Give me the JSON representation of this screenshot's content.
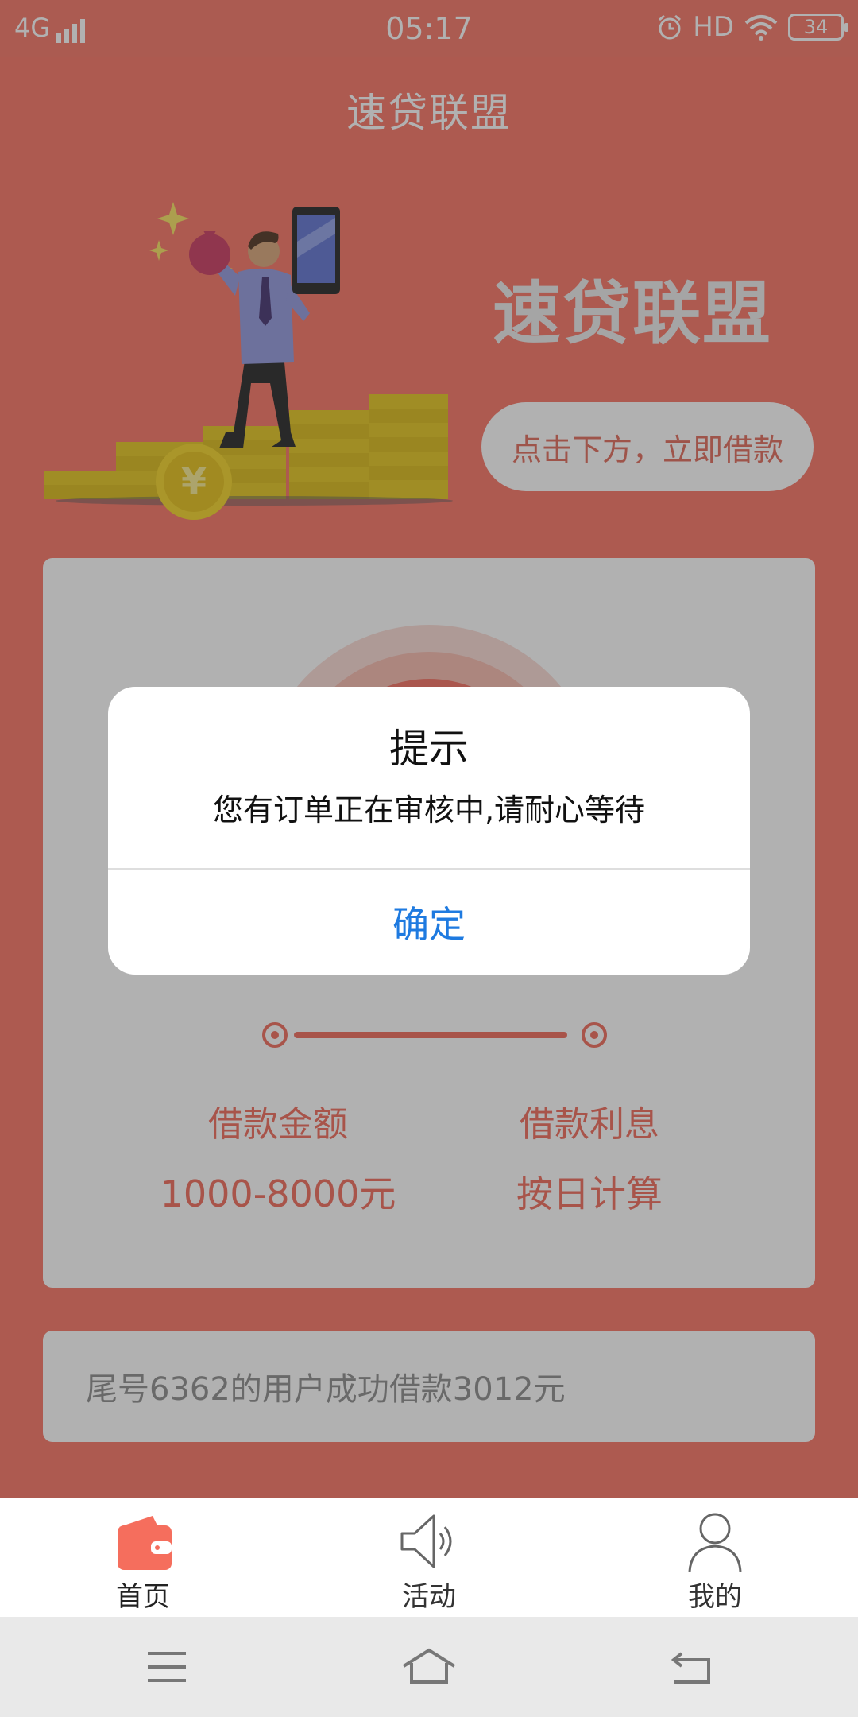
{
  "status_bar": {
    "network": "4G",
    "time": "05:17",
    "hd": "HD",
    "battery": "34"
  },
  "header": {
    "title": "速贷联盟"
  },
  "hero": {
    "brand": "速贷联盟",
    "cta": "点击下方，立即借款",
    "currency_symbol": "¥"
  },
  "loan_card": {
    "amount_label": "借款金额",
    "amount_value": "1000-8000元",
    "interest_label": "借款利息",
    "interest_value": "按日计算"
  },
  "ticker": {
    "text": "尾号6362的用户成功借款3012元"
  },
  "dialog": {
    "title": "提示",
    "message": "您有订单正在审核中,请耐心等待",
    "confirm": "确定"
  },
  "tab_bar": {
    "items": [
      {
        "label": "首页",
        "icon": "wallet-icon",
        "active": true
      },
      {
        "label": "活动",
        "icon": "speaker-icon",
        "active": false
      },
      {
        "label": "我的",
        "icon": "user-icon",
        "active": false
      }
    ],
    "active_color": "#f56e5d",
    "inactive_color": "#555555"
  },
  "colors": {
    "brand": "#f86e5e",
    "dialog_button": "#1e7ae0"
  }
}
